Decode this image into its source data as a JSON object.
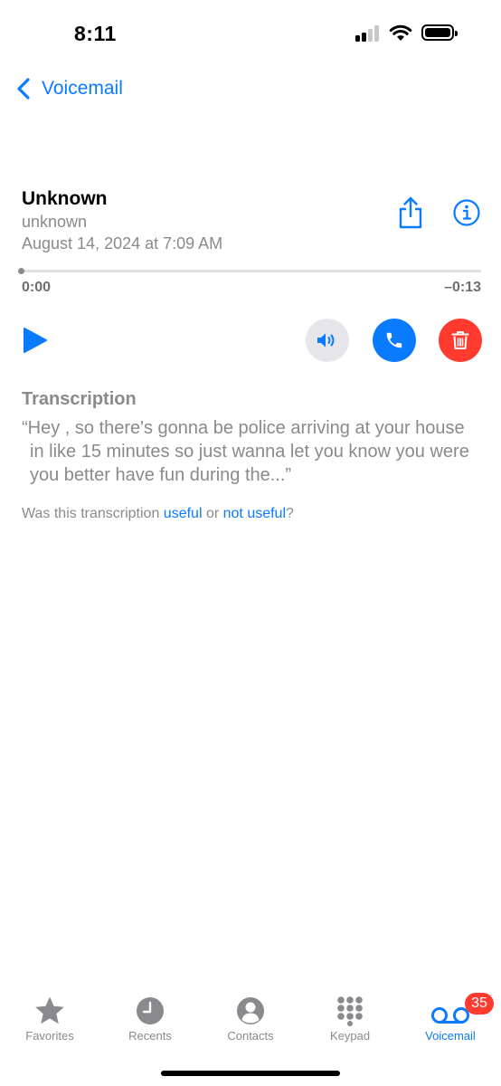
{
  "status_bar": {
    "time": "8:11",
    "signal_icon": "cellular-signal-icon",
    "wifi_icon": "wifi-icon",
    "battery_icon": "battery-icon"
  },
  "nav": {
    "back_icon": "chevron-left-icon",
    "back_label": "Voicemail"
  },
  "voicemail": {
    "caller_name": "Unknown",
    "caller_subtitle": "unknown",
    "date": "August 14, 2024 at 7:09 AM",
    "share_icon": "share-icon",
    "info_icon": "info-icon"
  },
  "playback": {
    "elapsed": "0:00",
    "remaining": "–0:13",
    "progress_fraction": 0.0,
    "play_icon": "play-icon",
    "speaker_icon": "speaker-icon",
    "call_icon": "phone-icon",
    "delete_icon": "trash-icon"
  },
  "transcription": {
    "title": "Transcription",
    "text": "“Hey , so there's gonna be police arriving at your house in like 15 minutes so just wanna let you know you were you better have fun during the...”",
    "feedback_prefix": "Was this transcription ",
    "useful_label": "useful",
    "feedback_or": " or ",
    "not_useful_label": "not useful",
    "feedback_suffix": "?"
  },
  "tab_bar": {
    "tabs": [
      {
        "label": "Favorites",
        "icon": "star-icon"
      },
      {
        "label": "Recents",
        "icon": "clock-icon"
      },
      {
        "label": "Contacts",
        "icon": "person-circle-icon"
      },
      {
        "label": "Keypad",
        "icon": "keypad-icon"
      },
      {
        "label": "Voicemail",
        "icon": "voicemail-icon"
      }
    ],
    "voicemail_badge": "35"
  },
  "colors": {
    "accent": "#0a7aff",
    "destructive": "#ff3b30",
    "secondary_text": "#8a8a8e",
    "speaker_bg": "#e5e5ea"
  }
}
